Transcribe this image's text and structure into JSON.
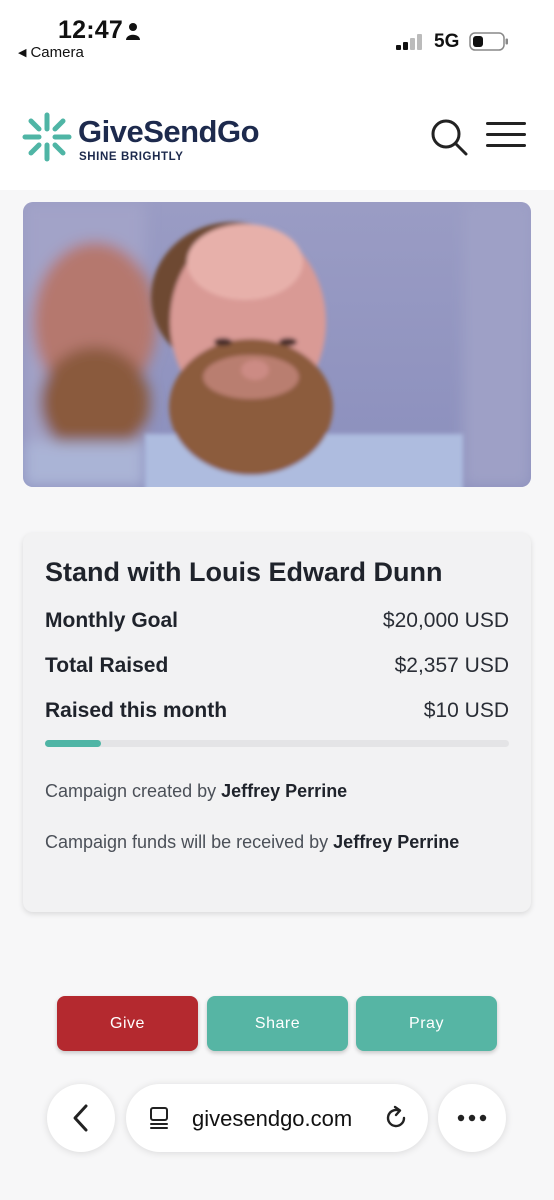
{
  "status_bar": {
    "time": "12:47",
    "back_app": "Camera",
    "network": "5G"
  },
  "site": {
    "logo_name": "GiveSendGo",
    "tagline": "SHINE BRIGHTLY",
    "icons": {
      "search": "search-icon",
      "menu": "hamburger-menu-icon"
    }
  },
  "campaign": {
    "title": "Stand with Louis Edward Dunn",
    "monthly_goal_label": "Monthly Goal",
    "monthly_goal_value": "$20,000 USD",
    "total_raised_label": "Total Raised",
    "total_raised_value": "$2,357 USD",
    "raised_month_label": "Raised this month",
    "raised_month_value": "$10 USD",
    "progress_fraction": 0.12,
    "created_by_prefix": "Campaign created by",
    "created_by_name": "Jeffrey Perrine",
    "funds_prefix": "Campaign funds will be received by",
    "funds_name": "Jeffrey Perrine"
  },
  "actions": {
    "give": "Give",
    "share": "Share",
    "pray": "Pray"
  },
  "browser": {
    "url": "givesendgo.com"
  },
  "colors": {
    "brand_navy": "#1d2a4d",
    "brand_teal": "#4fb5a5",
    "give_red": "#b4292f"
  }
}
